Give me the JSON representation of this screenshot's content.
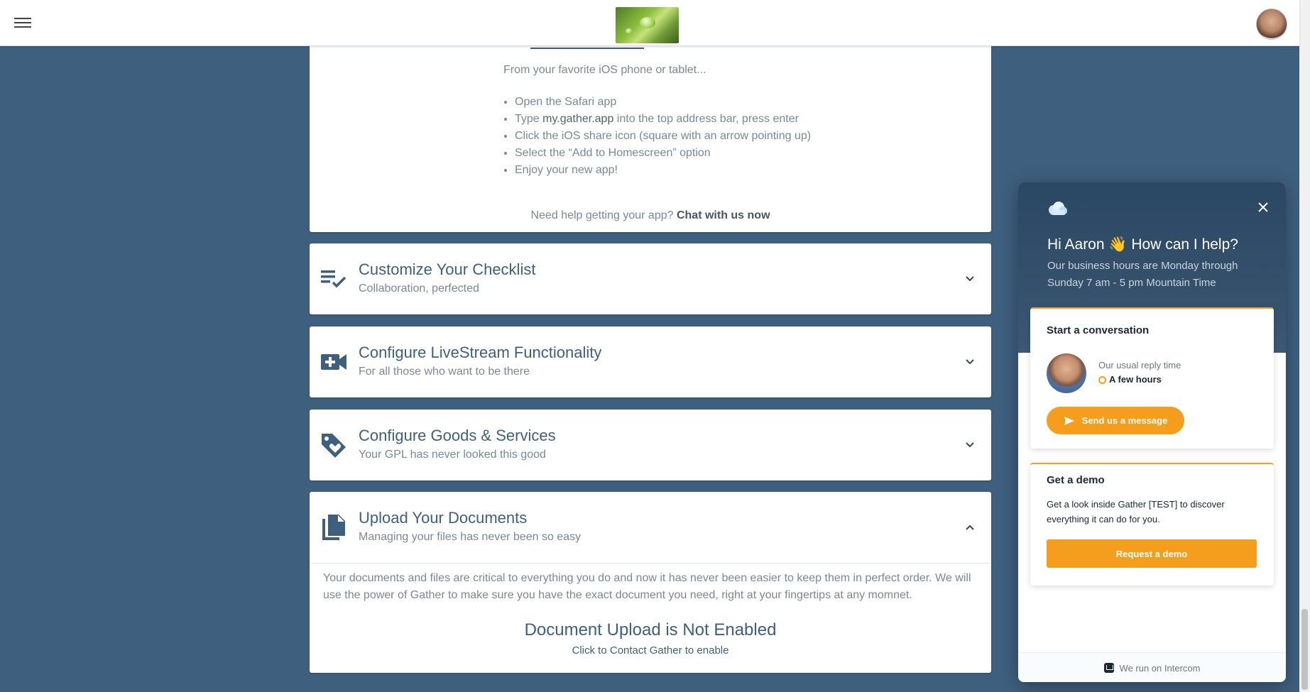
{
  "header": {
    "menu_icon": "hamburger-menu-icon",
    "logo_icon": "leaf-water-drop-logo",
    "avatar_icon": "user-avatar"
  },
  "app_card": {
    "intro": "From your favorite iOS phone or tablet...",
    "steps": [
      {
        "pre": "Open the Safari app",
        "bold": "",
        "post": ""
      },
      {
        "pre": "Type ",
        "bold": "my.gather.app",
        "post": " into the top address bar, press enter"
      },
      {
        "pre": "Click the iOS share icon (square with an arrow pointing up)",
        "bold": "",
        "post": ""
      },
      {
        "pre": "Select the “Add to Homescreen” option",
        "bold": "",
        "post": ""
      },
      {
        "pre": "Enjoy your new app!",
        "bold": "",
        "post": ""
      }
    ],
    "help_text": "Need help getting your app?",
    "help_link": "Chat with us now"
  },
  "accordion": [
    {
      "title": "Customize Your Checklist",
      "subtitle": "Collaboration, perfected",
      "icon": "checklist-icon",
      "expanded": false
    },
    {
      "title": "Configure LiveStream Functionality",
      "subtitle": "For all those who want to be there",
      "icon": "video-add-icon",
      "expanded": false
    },
    {
      "title": "Configure Goods & Services",
      "subtitle": "Your GPL has never looked this good",
      "icon": "tag-heart-icon",
      "expanded": false
    },
    {
      "title": "Upload Your Documents",
      "subtitle": "Managing your files has never been so easy",
      "icon": "documents-icon",
      "expanded": true
    }
  ],
  "documents": {
    "body": "Your documents and files are critical to everything you do and now it has never been easier to keep them in perfect order. We will use the power of Gather to make sure you have the exact document you need, right at your fingertips at any momnet.",
    "disabled_title": "Document Upload is Not Enabled",
    "enable_link": "Click to Contact Gather to enable"
  },
  "intercom": {
    "greeting": "Hi Aaron 👋 How can I help?",
    "hours": "Our business hours are Monday through Sunday 7 am - 5 pm Mountain Time",
    "start_title": "Start a conversation",
    "reply_label": "Our usual reply time",
    "reply_time": "A few hours",
    "send_button": "Send us a message",
    "demo_title": "Get a demo",
    "demo_text": "Get a look inside Gather [TEST] to discover everything it can do for you.",
    "demo_button": "Request a demo",
    "footer": "We run on Intercom",
    "accent_color": "#f59d1c"
  },
  "colors": {
    "page_background": "#3f5f7f",
    "heading": "#3f5f7f",
    "muted_text": "#7d8790"
  }
}
